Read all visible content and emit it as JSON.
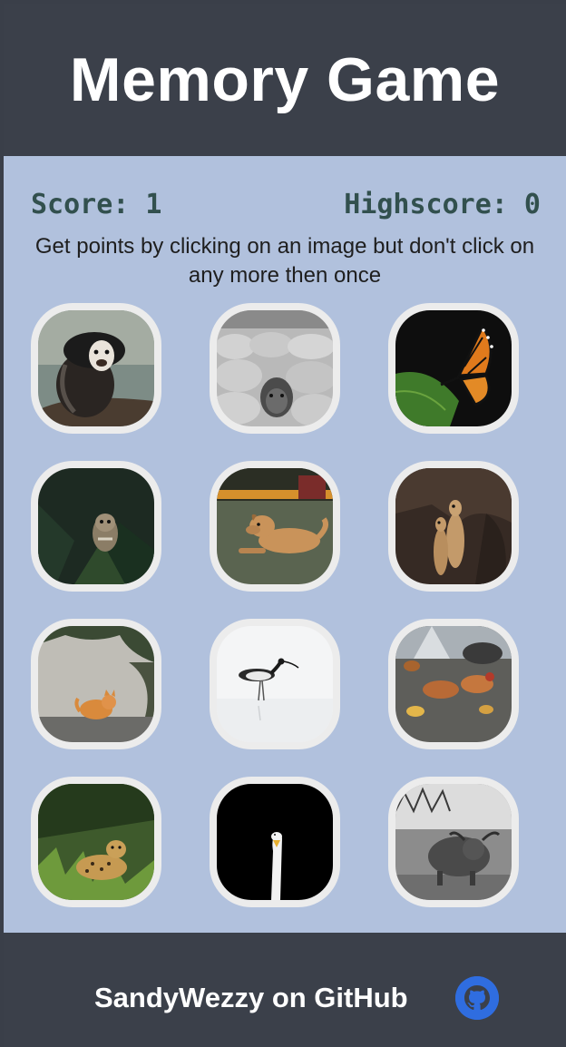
{
  "header": {
    "title": "Memory Game"
  },
  "scoreboard": {
    "score_text": "Score: 1",
    "highscore_text": "Highscore: 0"
  },
  "instructions": "Get points by clicking on an image but don't click on any more then once",
  "cards": [
    {
      "icon": "monkey-photo"
    },
    {
      "icon": "sheep-photo"
    },
    {
      "icon": "butterfly-photo"
    },
    {
      "icon": "owl-photo"
    },
    {
      "icon": "dog-photo"
    },
    {
      "icon": "meerkat-photo"
    },
    {
      "icon": "cat-photo"
    },
    {
      "icon": "bird-photo"
    },
    {
      "icon": "chicken-photo"
    },
    {
      "icon": "leopard-photo"
    },
    {
      "icon": "swan-photo"
    },
    {
      "icon": "cow-photo"
    }
  ],
  "footer": {
    "credit": "SandyWezzy on GitHub",
    "icon": "github-icon"
  },
  "colors": {
    "header_bg": "#3b404a",
    "main_bg": "#b1c1dd",
    "score_text": "#32504e",
    "card_border": "#ececec",
    "github_icon": "#2f6de0"
  }
}
